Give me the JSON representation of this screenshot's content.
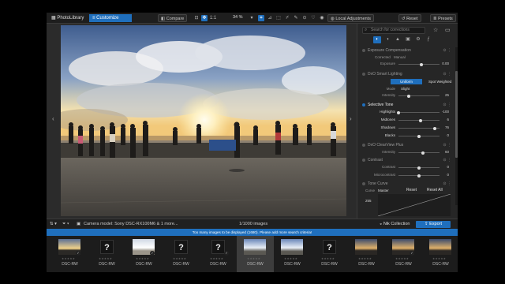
{
  "topbar": {
    "library_tab": "PhotoLibrary",
    "customize_tab": "Customize",
    "compare_label": "Compare",
    "ratio_label": "1:1",
    "zoom_value": "34 %",
    "local_adjustments": "Local Adjustments",
    "reset_label": "Reset",
    "presets_label": "Presets"
  },
  "panel": {
    "search_placeholder": "Search for corrections",
    "sections": {
      "exposure": {
        "title": "Exposure Compensation",
        "mode_a": "Corrected",
        "mode_b": "Manual",
        "exposure_label": "Exposure",
        "exposure_value": "0.00",
        "exposure_level": 0.55
      },
      "smart_lighting": {
        "title": "DxO Smart Lighting",
        "uniform_label": "Uniform",
        "spot_label": "Spot Weighted",
        "mode_label": "Mode",
        "mode_value": "Slight",
        "intensity_label": "Intensity",
        "intensity_value": "25",
        "intensity_level": 0.25
      },
      "selective_tone": {
        "title": "Selective Tone",
        "rows": [
          {
            "label": "Highlights",
            "value": "-100",
            "level": 0.0
          },
          {
            "label": "Midtones",
            "value": "6",
            "level": 0.53
          },
          {
            "label": "Shadows",
            "value": "76",
            "level": 0.88
          },
          {
            "label": "Blacks",
            "value": "0",
            "level": 0.5
          }
        ]
      },
      "clearview": {
        "title": "DxO ClearView Plus",
        "intensity_label": "Intensity",
        "intensity_value": "60",
        "intensity_level": 0.6
      },
      "contrast": {
        "title": "Contrast",
        "rows": [
          {
            "label": "Contrast",
            "value": "0",
            "level": 0.5
          },
          {
            "label": "Microcontrast",
            "value": "0",
            "level": 0.5
          }
        ]
      },
      "tone_curve": {
        "title": "Tone Curve",
        "curve_label": "Curve",
        "curve_value": "Master",
        "reset_label": "Reset",
        "reset_all_label": "Reset All",
        "value": "255"
      }
    }
  },
  "bottombar": {
    "camera_model": "Camera model: Sony DSC-RX100M6 & 1 more...",
    "image_count": "1/1000 images",
    "nik_collection": "Nik Collection",
    "export": "Export"
  },
  "infobar": {
    "message": "Too many images to be displayed (1680). Please add more search criteria!"
  },
  "filmstrip": {
    "items": [
      {
        "kind": "photo",
        "label": "DSC-RW",
        "tone": "sunset",
        "checked": true
      },
      {
        "kind": "missing",
        "label": "DSC-RW",
        "checked": false
      },
      {
        "kind": "photo",
        "label": "DSC-RW",
        "tone": "bright",
        "checked": true
      },
      {
        "kind": "missing",
        "label": "DSC-RW",
        "checked": false
      },
      {
        "kind": "missing",
        "label": "DSC-RW",
        "checked": true
      },
      {
        "kind": "photo",
        "label": "DSC-RW",
        "tone": "sky",
        "checked": false,
        "selected": true
      },
      {
        "kind": "photo",
        "label": "DSC-RW",
        "tone": "sky",
        "checked": false
      },
      {
        "kind": "missing",
        "label": "DSC-RW",
        "checked": false
      },
      {
        "kind": "photo",
        "label": "DSC-RW",
        "tone": "dusk",
        "checked": false
      },
      {
        "kind": "photo",
        "label": "DSC-RW",
        "tone": "dusk",
        "checked": true
      },
      {
        "kind": "photo",
        "label": "DSC-RW",
        "tone": "dusk",
        "checked": false
      }
    ]
  },
  "colors": {
    "accent": "#1f6fbd",
    "background": "#2b2b2b"
  }
}
